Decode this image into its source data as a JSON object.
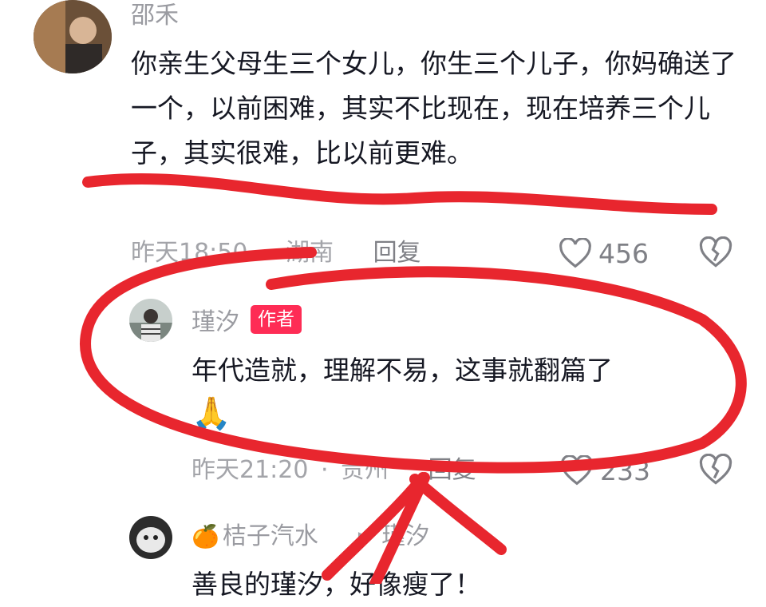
{
  "comment1": {
    "author": "邵禾",
    "text": "你亲生父母生三个女儿，你生三个儿子，你妈确送了一个，以前困难，其实不比现在，现在培养三个儿子，其实很难，比以前更难。",
    "time": "昨天18:50",
    "location": "湖南",
    "reply_label": "回复",
    "likes": "456"
  },
  "reply1": {
    "author": "瑾汐",
    "badge": "作者",
    "text": "年代造就，理解不易，这事就翻篇了",
    "emoji": "🙏",
    "time": "昨天21:20",
    "separator": "·",
    "location": "贵州",
    "reply_label": "回复",
    "likes": "233"
  },
  "reply2": {
    "author_prefix_emoji": "🍊",
    "author": "桔子汽水",
    "arrow": "▶",
    "reply_to": "瑾汐",
    "text": "善良的瑾汐，好像瘦了！"
  },
  "colors": {
    "annotation_red": "#e8262e",
    "badge_red": "#fe2c55",
    "meta_gray": "#a3a4a9"
  }
}
